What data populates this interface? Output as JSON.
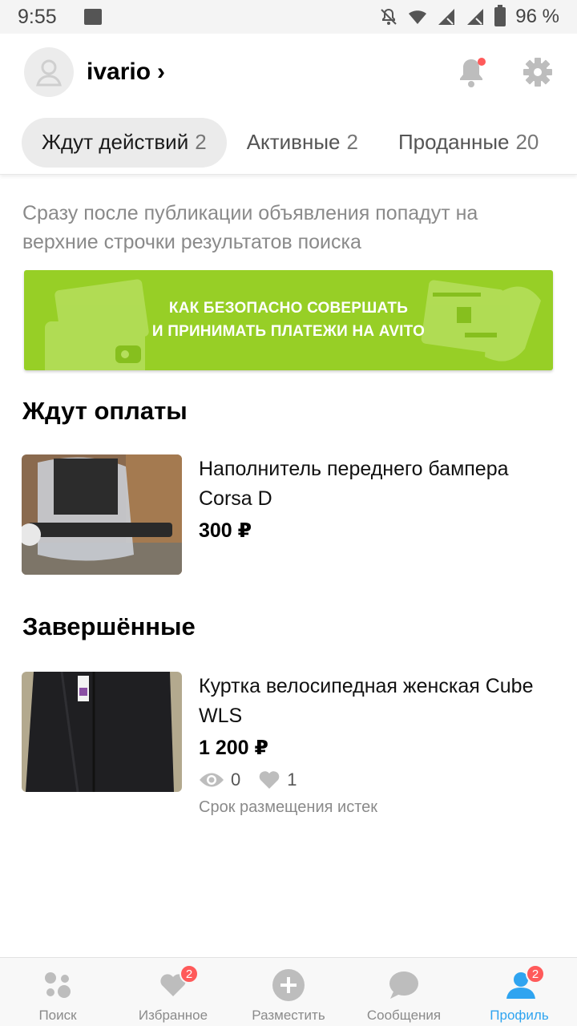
{
  "status_bar": {
    "time": "9:55",
    "battery": "96 %"
  },
  "header": {
    "username": "ivario"
  },
  "tabs": [
    {
      "label": "Ждут действий",
      "count": "2"
    },
    {
      "label": "Активные",
      "count": "2"
    },
    {
      "label": "Проданные",
      "count": "20"
    }
  ],
  "hint": "Сразу после публикации объявления попадут на верхние строчки результатов поиска",
  "banner": {
    "line1": "КАК БЕЗОПАСНО СОВЕРШАТЬ",
    "line2": "И ПРИНИМАТЬ ПЛАТЕЖИ НА AVITO"
  },
  "sections": {
    "awaiting_payment": {
      "title": "Ждут оплаты",
      "item": {
        "title": "Наполнитель переднего бампера Corsa D",
        "price": "300 ₽"
      }
    },
    "completed": {
      "title": "Завершённые",
      "item": {
        "title": "Куртка велосипедная женская Cube WLS",
        "price": "1 200 ₽",
        "views": "0",
        "favorites": "1",
        "status": "Срок размещения истек"
      }
    }
  },
  "bottom_nav": [
    {
      "label": "Поиск",
      "icon": "search-icon"
    },
    {
      "label": "Избранное",
      "icon": "heart-icon",
      "badge": "2"
    },
    {
      "label": "Разместить",
      "icon": "plus-icon"
    },
    {
      "label": "Сообщения",
      "icon": "chat-icon"
    },
    {
      "label": "Профиль",
      "icon": "profile-icon",
      "badge": "2",
      "active": true
    }
  ],
  "colors": {
    "accent_blue": "#2fa4f0",
    "banner_green": "#97cf26",
    "badge_red": "#ff5a5a"
  }
}
